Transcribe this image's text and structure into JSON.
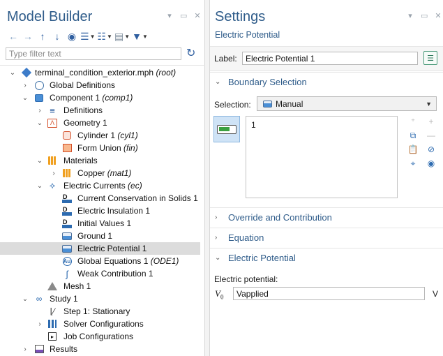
{
  "model_builder": {
    "title": "Model Builder",
    "filter_placeholder": "Type filter text",
    "tree": [
      {
        "label": "terminal_condition_exterior.mph",
        "tag": "(root)",
        "icon": "model-root-icon"
      },
      {
        "label": "Global Definitions",
        "tag": "",
        "icon": "globe-icon"
      },
      {
        "label": "Component 1",
        "tag": "(comp1)",
        "icon": "component-icon"
      },
      {
        "label": "Definitions",
        "tag": "",
        "icon": "definitions-icon"
      },
      {
        "label": "Geometry 1",
        "tag": "",
        "icon": "geometry-icon"
      },
      {
        "label": "Cylinder 1",
        "tag": "(cyl1)",
        "icon": "cylinder-icon"
      },
      {
        "label": "Form Union",
        "tag": "(fin)",
        "icon": "form-union-icon"
      },
      {
        "label": "Materials",
        "tag": "",
        "icon": "materials-icon"
      },
      {
        "label": "Copper",
        "tag": "(mat1)",
        "icon": "material-icon"
      },
      {
        "label": "Electric Currents",
        "tag": "(ec)",
        "icon": "electric-currents-icon"
      },
      {
        "label": "Current Conservation in Solids 1",
        "tag": "",
        "icon": "domain-feature-icon"
      },
      {
        "label": "Electric Insulation 1",
        "tag": "",
        "icon": "domain-feature-icon"
      },
      {
        "label": "Initial Values 1",
        "tag": "",
        "icon": "domain-feature-icon"
      },
      {
        "label": "Ground 1",
        "tag": "",
        "icon": "boundary-icon"
      },
      {
        "label": "Electric Potential 1",
        "tag": "",
        "icon": "boundary-icon"
      },
      {
        "label": "Global Equations 1",
        "tag": "(ODE1)",
        "icon": "global-equations-icon"
      },
      {
        "label": "Weak Contribution 1",
        "tag": "",
        "icon": "weak-contribution-icon"
      },
      {
        "label": "Mesh 1",
        "tag": "",
        "icon": "mesh-icon"
      },
      {
        "label": "Study 1",
        "tag": "",
        "icon": "study-icon"
      },
      {
        "label": "Step 1: Stationary",
        "tag": "",
        "icon": "stationary-step-icon"
      },
      {
        "label": "Solver Configurations",
        "tag": "",
        "icon": "solver-configurations-icon"
      },
      {
        "label": "Job Configurations",
        "tag": "",
        "icon": "job-configurations-icon"
      },
      {
        "label": "Results",
        "tag": "",
        "icon": "results-icon"
      }
    ],
    "selected_item": "Electric Potential 1"
  },
  "settings": {
    "title": "Settings",
    "subtitle": "Electric Potential",
    "label_caption": "Label:",
    "label_value": "Electric Potential 1",
    "sections": {
      "boundary_selection": "Boundary Selection",
      "override": "Override and Contribution",
      "equation": "Equation",
      "electric_potential": "Electric Potential"
    },
    "selection_caption": "Selection:",
    "selection_value": "Manual",
    "selection_items": [
      "1"
    ],
    "potential_caption": "Electric potential:",
    "potential_symbol": "V",
    "potential_subscript": "0",
    "potential_value": "Vapplied",
    "potential_unit": "V"
  }
}
